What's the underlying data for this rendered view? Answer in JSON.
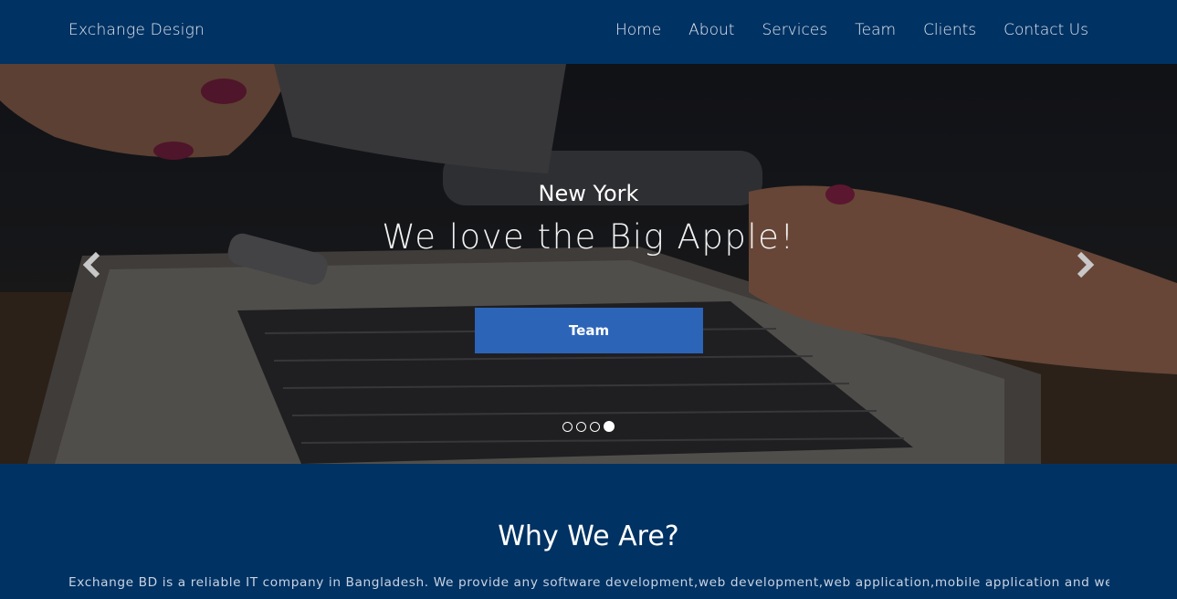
{
  "navbar": {
    "brand": "Exchange Design",
    "items": [
      "Home",
      "About",
      "Services",
      "Team",
      "Clients",
      "Contact Us"
    ]
  },
  "hero": {
    "city": "New York",
    "tagline": "We love the Big Apple!",
    "button_label": "Team",
    "slide_count": 4,
    "active_slide": 4
  },
  "why": {
    "title": "Why We Are?",
    "text": "Exchange BD is a reliable IT company in Bangladesh. We provide any software development,web development,web application,mobile application and web"
  },
  "colors": {
    "navy": "#003263",
    "button": "#2c64b8"
  }
}
